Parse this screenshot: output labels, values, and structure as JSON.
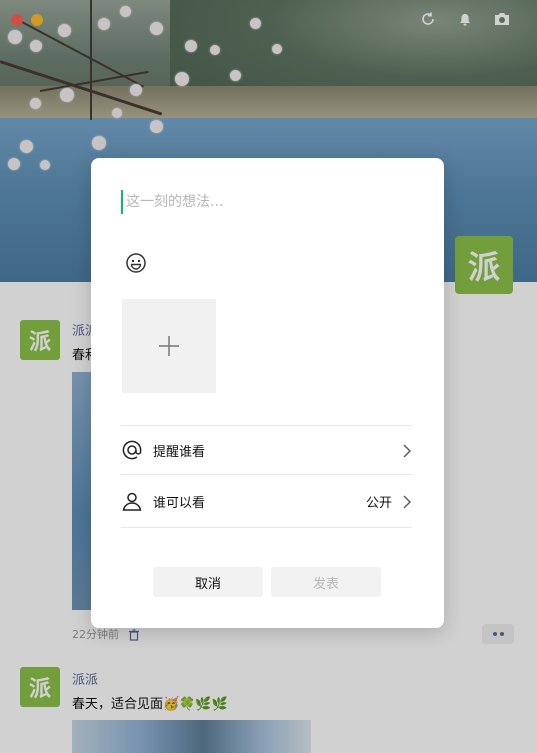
{
  "window": {
    "top_icons": [
      "refresh-icon",
      "bell-icon",
      "camera-icon"
    ],
    "avatar_char": "派"
  },
  "feed": {
    "posts": [
      {
        "avatar_char": "派",
        "name": "派派",
        "text": "春和",
        "time": "22分钟前"
      },
      {
        "avatar_char": "派",
        "name": "派派",
        "text": "春天，适合见面🥳🍀🌿🌿"
      }
    ]
  },
  "composer": {
    "placeholder": "这一刻的想法...",
    "emoji_icon": "smiley-icon",
    "add_photo_icon": "plus-icon",
    "remind": {
      "label": "提醒谁看",
      "icon": "at-icon"
    },
    "visibility": {
      "label": "谁可以看",
      "value": "公开",
      "icon": "person-icon"
    },
    "cancel_label": "取消",
    "post_label": "发表"
  },
  "colors": {
    "accent": "#07c160",
    "name_link": "#576b95",
    "avatar_bg": "#8bc34a"
  }
}
